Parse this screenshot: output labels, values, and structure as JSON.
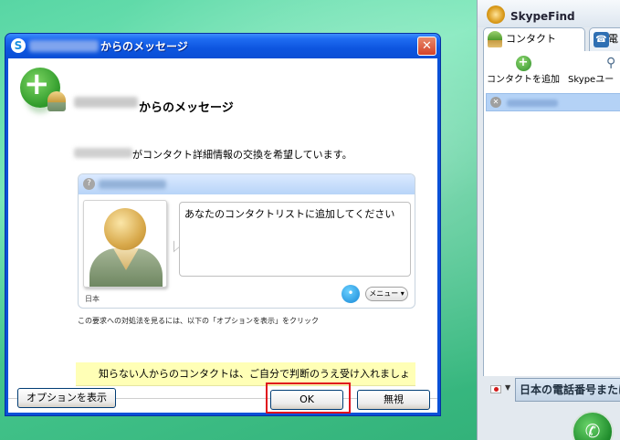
{
  "dialog": {
    "window_title": "からのメッセージ",
    "header_title": "からのメッセージ",
    "request_text": "がコンタクト詳細情報の交換を希望しています。",
    "message": "あなたのコンタクトリストに追加してください",
    "location": "日本",
    "menu_label": "メニュー",
    "options_hint": "この要求への対処法を見るには、以下の「オプションを表示」をクリック",
    "notice": "知らない人からのコンタクトは、ご自分で判断のうえ受け入れましょう。",
    "buttons": {
      "options": "オプションを表示",
      "ok": "OK",
      "ignore": "無視"
    },
    "close_glyph": "✕"
  },
  "skype": {
    "app_title": "SkypeFind",
    "tabs": [
      {
        "label": "コンタクト"
      },
      {
        "label": "電"
      }
    ],
    "toolbar": {
      "add_contact": "コンタクトを追加",
      "skype_user": "Skypeユー"
    },
    "dial_placeholder": "日本の電話番号または"
  },
  "colors": {
    "highlight": "#e0101c",
    "notice_bg": "#ffffb6",
    "titlebar": "#0a51d8"
  }
}
